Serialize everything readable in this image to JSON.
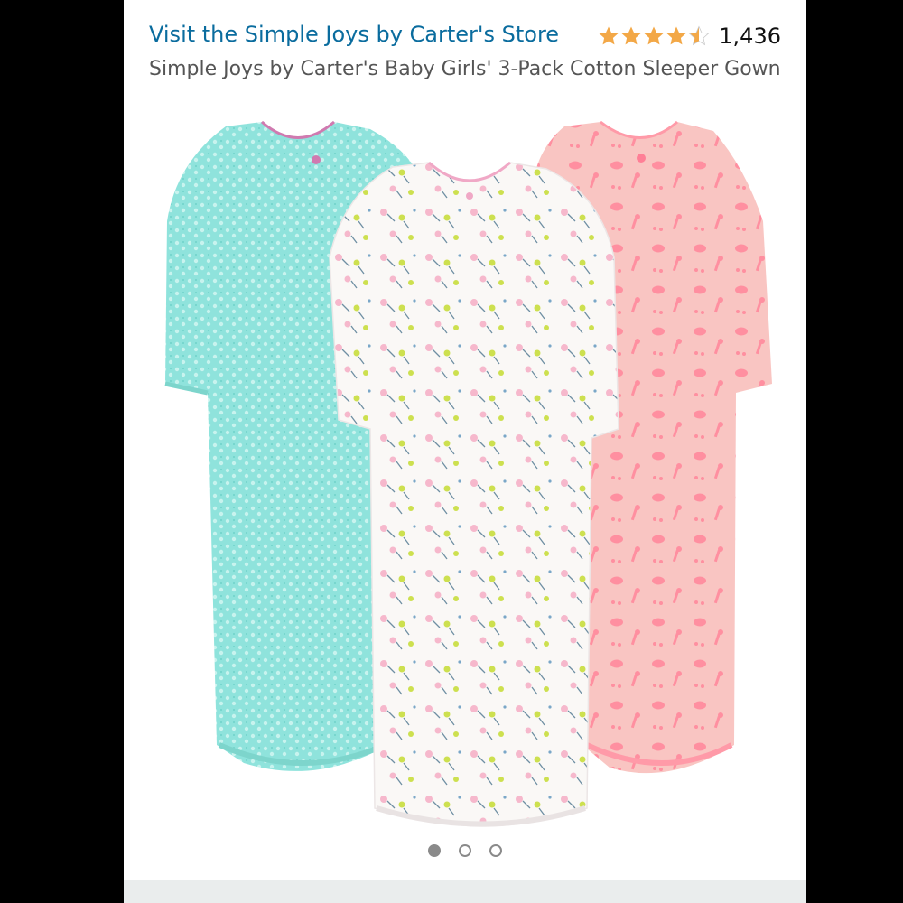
{
  "store_link": "Visit the Simple Joys by Carter's Store",
  "rating": {
    "stars": 4.5,
    "count": "1,436",
    "star_color": "#f3a847"
  },
  "product_title": "Simple Joys by Carter's Baby Girls' 3-Pack Cotton Sleeper Gown",
  "colors": {
    "link": "#0a6c9e",
    "gown_teal": "#8fe3dc",
    "gown_white": "#faf8f6",
    "gown_pink": "#f9b8b5"
  },
  "carousel": {
    "total": 3,
    "active": 1
  }
}
